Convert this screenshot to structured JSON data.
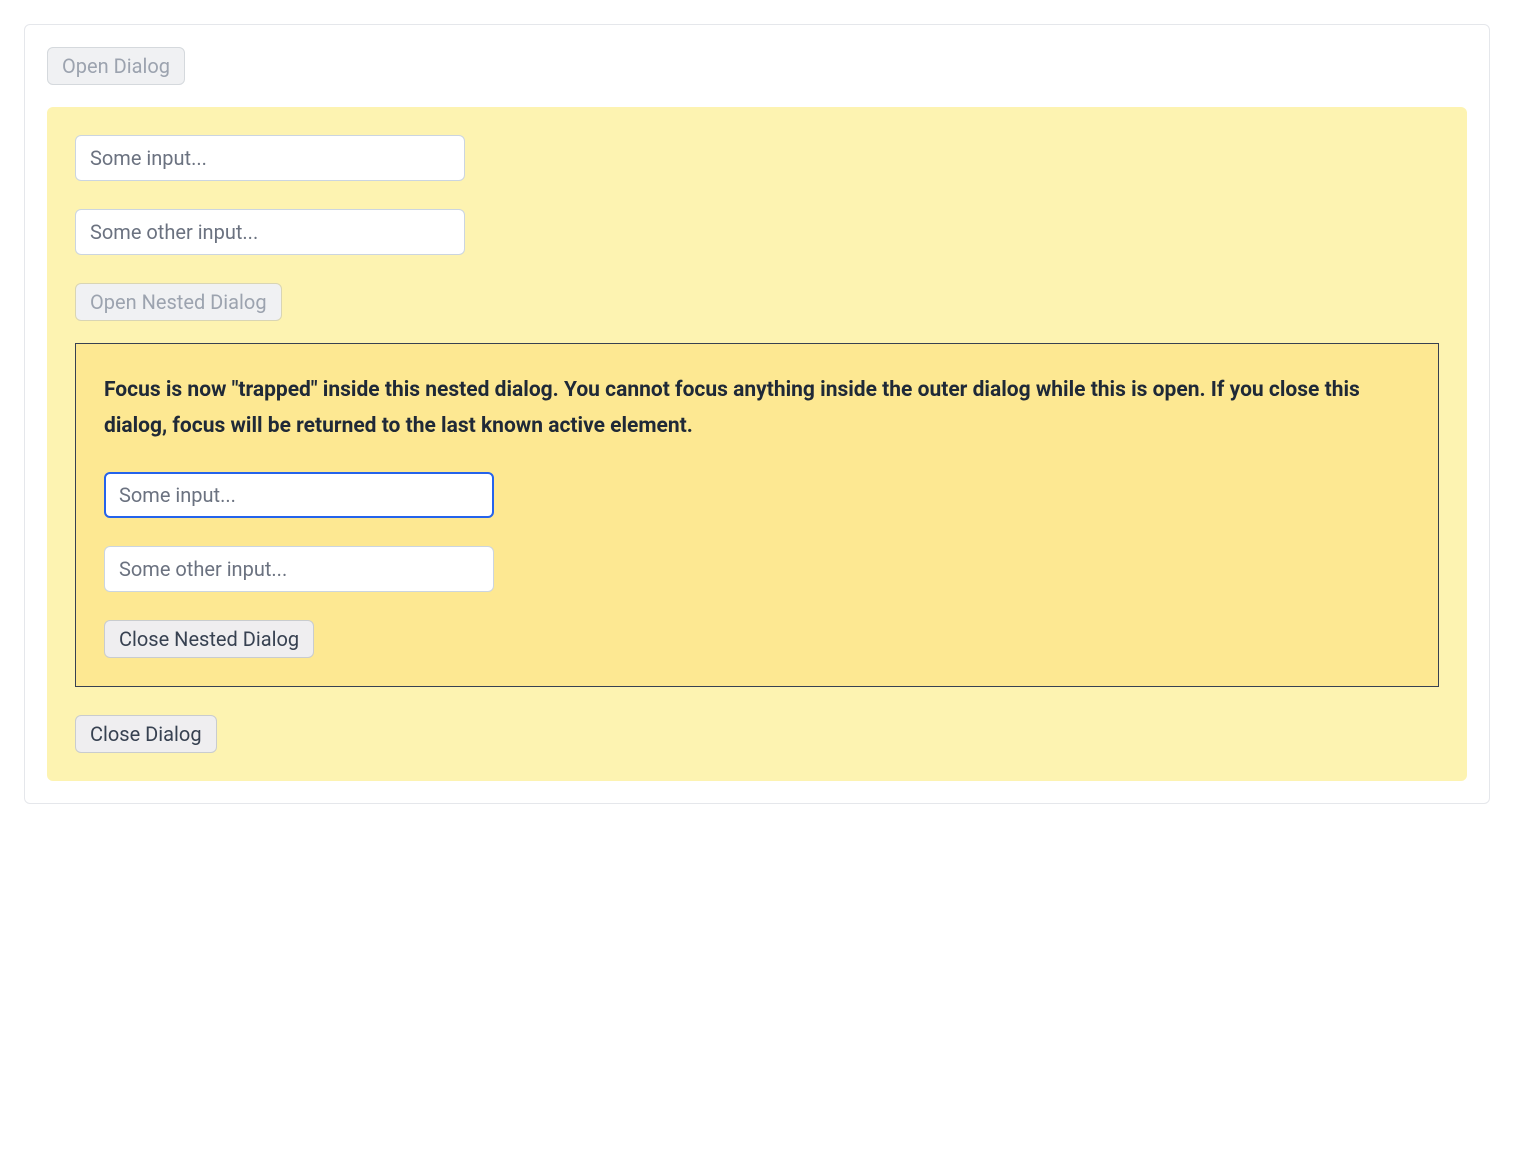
{
  "toolbar": {
    "open_dialog_label": "Open Dialog"
  },
  "outer_dialog": {
    "input1_placeholder": "Some input...",
    "input2_placeholder": "Some other input...",
    "open_nested_label": "Open Nested Dialog",
    "close_label": "Close Dialog"
  },
  "nested_dialog": {
    "description": "Focus is now \"trapped\" inside this nested dialog. You cannot focus anything inside the outer dialog while this is open. If you close this dialog, focus will be returned to the last known active element.",
    "input1_placeholder": "Some input...",
    "input2_placeholder": "Some other input...",
    "close_label": "Close Nested Dialog"
  },
  "colors": {
    "outer_dialog_bg": "#fdf3b1",
    "nested_dialog_bg": "#fde892",
    "focus_border": "#2563eb"
  }
}
